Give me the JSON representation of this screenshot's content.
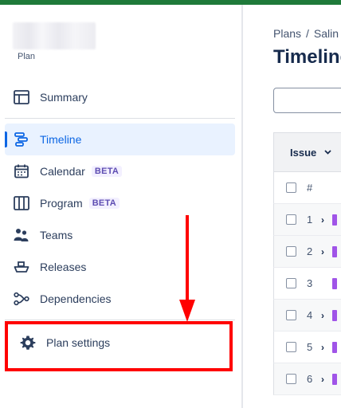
{
  "plan": {
    "subtitle": "Plan"
  },
  "nav": {
    "summary": "Summary",
    "timeline": "Timeline",
    "calendar": "Calendar",
    "calendar_badge": "BETA",
    "program": "Program",
    "program_badge": "BETA",
    "teams": "Teams",
    "releases": "Releases",
    "dependencies": "Dependencies",
    "plan_settings": "Plan settings"
  },
  "main": {
    "breadcrumb": [
      "Plans",
      "/",
      "Salin"
    ],
    "title": "Timeline",
    "table": {
      "issue_header": "Issue",
      "number_header": "#",
      "rows": [
        {
          "num": "1",
          "expandable": true
        },
        {
          "num": "2",
          "expandable": true
        },
        {
          "num": "3",
          "expandable": false
        },
        {
          "num": "4",
          "expandable": true
        },
        {
          "num": "5",
          "expandable": true
        },
        {
          "num": "6",
          "expandable": true
        }
      ]
    }
  },
  "colors": {
    "top_bar": "#1f7a3a",
    "active": "#0c66e4",
    "annotation": "#ff0000",
    "issue_marker": "#a054e8"
  },
  "icons": {
    "summary": "panel-icon",
    "timeline": "timeline-icon",
    "calendar": "calendar-icon",
    "program": "columns-icon",
    "teams": "people-icon",
    "releases": "ship-icon",
    "dependencies": "dependency-icon",
    "settings": "gear-icon"
  }
}
